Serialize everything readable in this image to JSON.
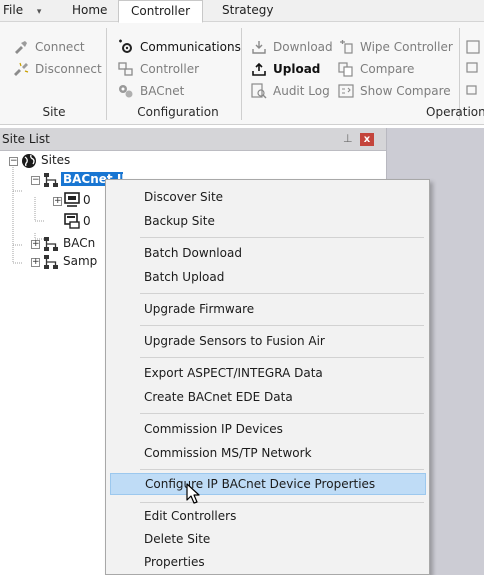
{
  "menu": {
    "file": "File",
    "file_arrow": "▾",
    "tabs": [
      "Home",
      "Controller",
      "Strategy"
    ]
  },
  "ribbon": {
    "site": {
      "connect": "Connect",
      "disconnect": "Disconnect",
      "label": "Site"
    },
    "configuration": {
      "communications": "Communications",
      "controller": "Controller",
      "bacnet": "BACnet",
      "label": "Configuration"
    },
    "operations": {
      "download": "Download",
      "upload": "Upload",
      "audit_log": "Audit Log",
      "wipe_controller": "Wipe Controller",
      "compare": "Compare",
      "show_compare": "Show Compare",
      "label": "Operation"
    }
  },
  "site_list": {
    "title": "Site List",
    "pin_glyph": "⊥",
    "close_glyph": "x",
    "root": "Sites",
    "selected_node": "BACnet IP",
    "children": [
      "0",
      "0"
    ],
    "other_nodes": [
      "BACn",
      "Samp"
    ]
  },
  "context_menu": {
    "groups": [
      [
        "Discover Site",
        "Backup Site"
      ],
      [
        "Batch Download",
        "Batch Upload"
      ],
      [
        "Upgrade Firmware"
      ],
      [
        "Upgrade Sensors to Fusion Air"
      ],
      [
        "Export ASPECT/INTEGRA Data",
        "Create BACnet EDE Data"
      ],
      [
        "Commission IP Devices",
        "Commission MS/TP Network"
      ],
      [
        "Configure IP BACnet Device Properties"
      ],
      [
        "Edit Controllers",
        "Delete Site",
        "Properties"
      ]
    ],
    "highlighted": "Configure IP BACnet Device Properties"
  },
  "colors": {
    "accent": "#1976d2",
    "menu_highlight": "#bfdcf6",
    "panel_header": "#d5d5d8",
    "close_red": "#c4453c",
    "workspace": "#ccccd4"
  }
}
